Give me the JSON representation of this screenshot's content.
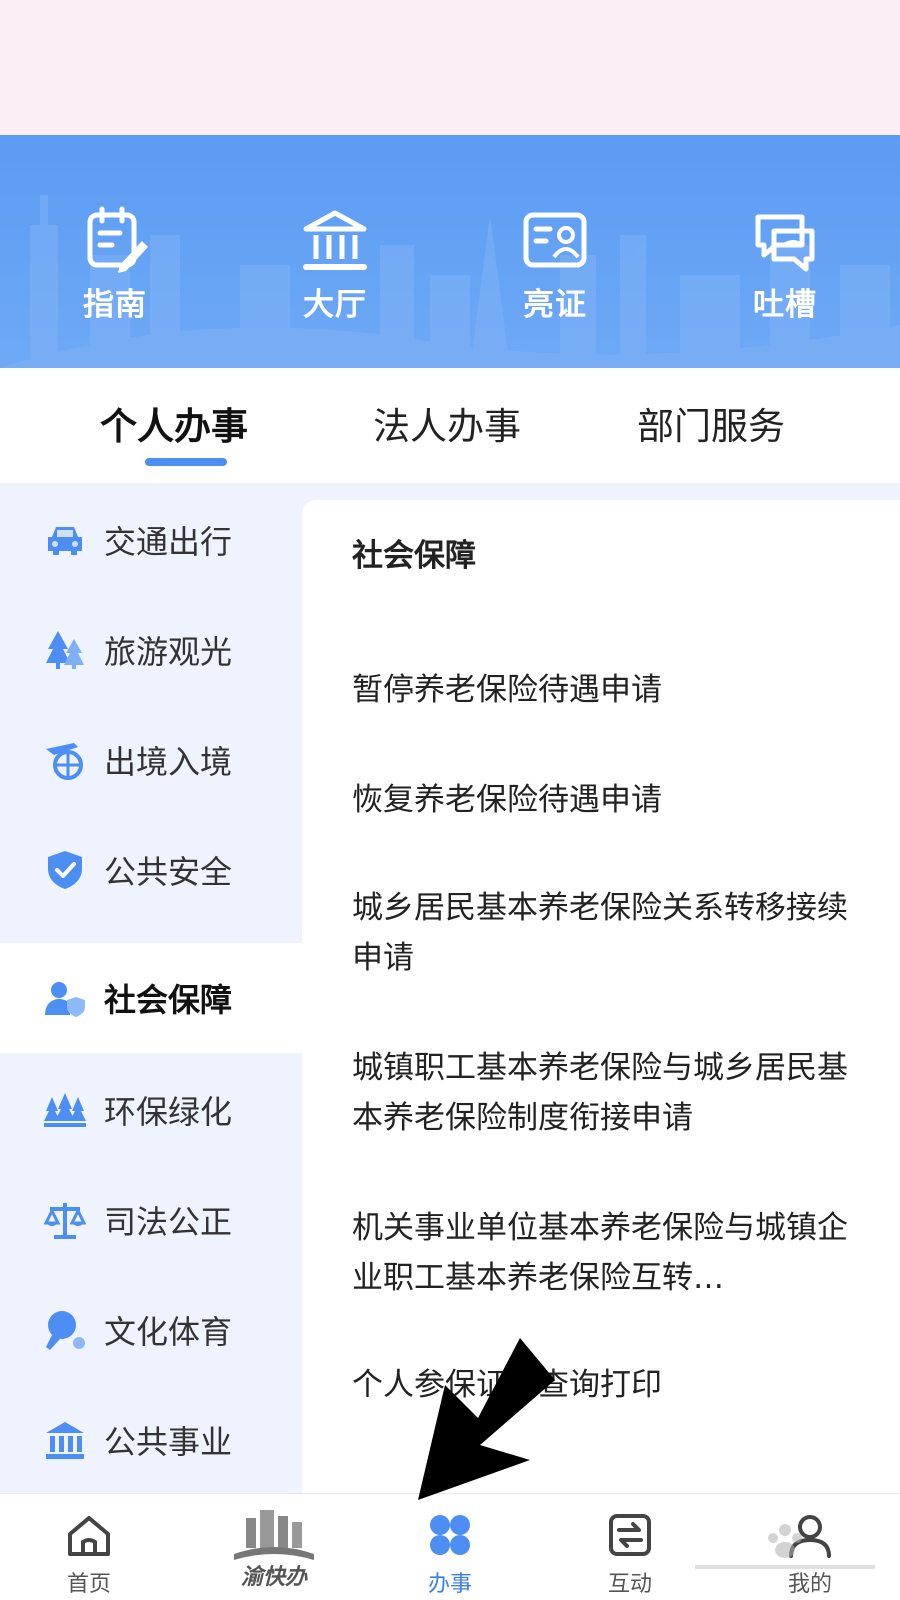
{
  "quick_actions": [
    {
      "label": "指南",
      "icon": "guide-icon"
    },
    {
      "label": "大厅",
      "icon": "hall-icon"
    },
    {
      "label": "亮证",
      "icon": "id-card-icon"
    },
    {
      "label": "吐槽",
      "icon": "feedback-icon"
    }
  ],
  "tabs": [
    {
      "label": "个人办事",
      "active": true
    },
    {
      "label": "法人办事",
      "active": false
    },
    {
      "label": "部门服务",
      "active": false
    }
  ],
  "sidebar": {
    "items": [
      {
        "label": "交通出行",
        "icon": "car-icon"
      },
      {
        "label": "旅游观光",
        "icon": "trees-icon"
      },
      {
        "label": "出境入境",
        "icon": "plane-globe-icon"
      },
      {
        "label": "公共安全",
        "icon": "shield-icon"
      },
      {
        "label": "社会保障",
        "icon": "person-shield-icon",
        "active": true
      },
      {
        "label": "环保绿化",
        "icon": "forest-icon"
      },
      {
        "label": "司法公正",
        "icon": "scales-icon"
      },
      {
        "label": "文化体育",
        "icon": "ping-pong-icon"
      },
      {
        "label": "公共事业",
        "icon": "building-icon"
      }
    ]
  },
  "main": {
    "section_title": "社会保障",
    "services": [
      "暂停养老保险待遇申请",
      "恢复养老保险待遇申请",
      "城乡居民基本养老保险关系转移接续申请",
      "城镇职工基本养老保险与城乡居民基本养老保险制度衔接申请",
      "机关事业单位基本养老保险与城镇企业职工基本养老保险互转…",
      "个人参保证明查询打印"
    ]
  },
  "bottom_nav": {
    "items": [
      {
        "label": "首页",
        "icon": "home-icon"
      },
      {
        "label": "渝快办",
        "icon": "brand-logo-icon"
      },
      {
        "label": "办事",
        "icon": "grid-icon",
        "active": true
      },
      {
        "label": "互动",
        "icon": "swap-icon"
      },
      {
        "label": "我的",
        "icon": "user-icon"
      }
    ]
  },
  "colors": {
    "accent": "#4d8ef2",
    "hero": "#5b9bf3",
    "sidebar_bg": "#eef3fd",
    "top_blank": "#fbeef4"
  }
}
